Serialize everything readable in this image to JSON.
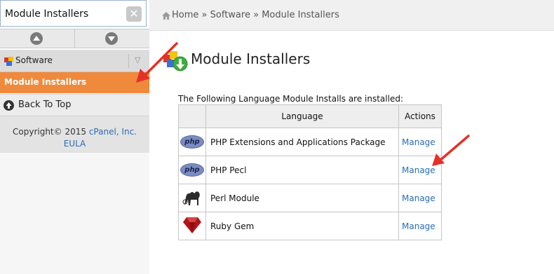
{
  "search": {
    "value": "Module Installers"
  },
  "sidebar": {
    "category_label": "Software",
    "active_item": "Module Installers",
    "back_to_top": "Back To Top",
    "footer": {
      "copyright": "Copyright© 2015",
      "brand": "cPanel, Inc.",
      "eula": "EULA"
    }
  },
  "breadcrumb": {
    "items": [
      "Home",
      "Software",
      "Module Installers"
    ],
    "separator": "»"
  },
  "page": {
    "title": "Module Installers",
    "intro": "The Following Language Module Installs are installed:"
  },
  "table": {
    "headers": [
      "Language",
      "Actions"
    ],
    "rows": [
      {
        "icon": "php-icon",
        "name": "PHP Extensions and Applications Package",
        "action": "Manage"
      },
      {
        "icon": "php-icon",
        "name": "PHP Pecl",
        "action": "Manage"
      },
      {
        "icon": "perl-camel-icon",
        "name": "Perl Module",
        "action": "Manage"
      },
      {
        "icon": "ruby-gem-icon",
        "name": "Ruby Gem",
        "action": "Manage"
      }
    ]
  },
  "colors": {
    "accent": "#ef8a3c",
    "link": "#2a6db5",
    "annotation_arrow": "#e53127"
  }
}
